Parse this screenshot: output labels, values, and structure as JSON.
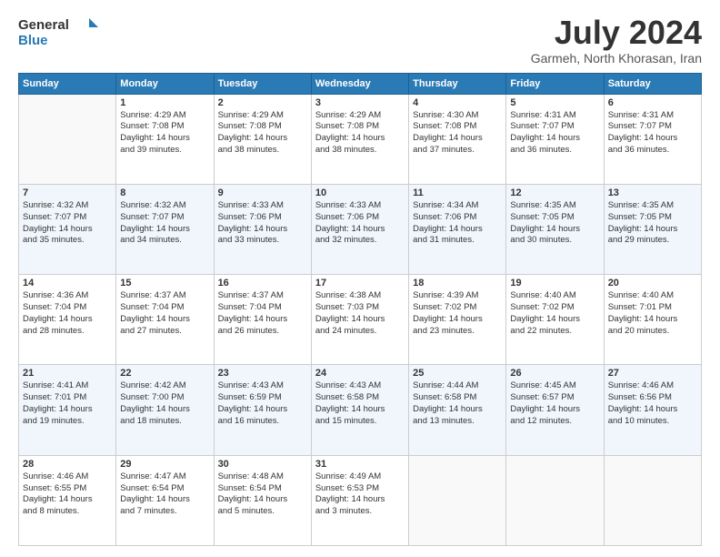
{
  "logo": {
    "line1": "General",
    "line2": "Blue"
  },
  "title": "July 2024",
  "subtitle": "Garmeh, North Khorasan, Iran",
  "days_header": [
    "Sunday",
    "Monday",
    "Tuesday",
    "Wednesday",
    "Thursday",
    "Friday",
    "Saturday"
  ],
  "weeks": [
    [
      {
        "day": "",
        "info": ""
      },
      {
        "day": "1",
        "info": "Sunrise: 4:29 AM\nSunset: 7:08 PM\nDaylight: 14 hours\nand 39 minutes."
      },
      {
        "day": "2",
        "info": "Sunrise: 4:29 AM\nSunset: 7:08 PM\nDaylight: 14 hours\nand 38 minutes."
      },
      {
        "day": "3",
        "info": "Sunrise: 4:29 AM\nSunset: 7:08 PM\nDaylight: 14 hours\nand 38 minutes."
      },
      {
        "day": "4",
        "info": "Sunrise: 4:30 AM\nSunset: 7:08 PM\nDaylight: 14 hours\nand 37 minutes."
      },
      {
        "day": "5",
        "info": "Sunrise: 4:31 AM\nSunset: 7:07 PM\nDaylight: 14 hours\nand 36 minutes."
      },
      {
        "day": "6",
        "info": "Sunrise: 4:31 AM\nSunset: 7:07 PM\nDaylight: 14 hours\nand 36 minutes."
      }
    ],
    [
      {
        "day": "7",
        "info": "Sunrise: 4:32 AM\nSunset: 7:07 PM\nDaylight: 14 hours\nand 35 minutes."
      },
      {
        "day": "8",
        "info": "Sunrise: 4:32 AM\nSunset: 7:07 PM\nDaylight: 14 hours\nand 34 minutes."
      },
      {
        "day": "9",
        "info": "Sunrise: 4:33 AM\nSunset: 7:06 PM\nDaylight: 14 hours\nand 33 minutes."
      },
      {
        "day": "10",
        "info": "Sunrise: 4:33 AM\nSunset: 7:06 PM\nDaylight: 14 hours\nand 32 minutes."
      },
      {
        "day": "11",
        "info": "Sunrise: 4:34 AM\nSunset: 7:06 PM\nDaylight: 14 hours\nand 31 minutes."
      },
      {
        "day": "12",
        "info": "Sunrise: 4:35 AM\nSunset: 7:05 PM\nDaylight: 14 hours\nand 30 minutes."
      },
      {
        "day": "13",
        "info": "Sunrise: 4:35 AM\nSunset: 7:05 PM\nDaylight: 14 hours\nand 29 minutes."
      }
    ],
    [
      {
        "day": "14",
        "info": "Sunrise: 4:36 AM\nSunset: 7:04 PM\nDaylight: 14 hours\nand 28 minutes."
      },
      {
        "day": "15",
        "info": "Sunrise: 4:37 AM\nSunset: 7:04 PM\nDaylight: 14 hours\nand 27 minutes."
      },
      {
        "day": "16",
        "info": "Sunrise: 4:37 AM\nSunset: 7:04 PM\nDaylight: 14 hours\nand 26 minutes."
      },
      {
        "day": "17",
        "info": "Sunrise: 4:38 AM\nSunset: 7:03 PM\nDaylight: 14 hours\nand 24 minutes."
      },
      {
        "day": "18",
        "info": "Sunrise: 4:39 AM\nSunset: 7:02 PM\nDaylight: 14 hours\nand 23 minutes."
      },
      {
        "day": "19",
        "info": "Sunrise: 4:40 AM\nSunset: 7:02 PM\nDaylight: 14 hours\nand 22 minutes."
      },
      {
        "day": "20",
        "info": "Sunrise: 4:40 AM\nSunset: 7:01 PM\nDaylight: 14 hours\nand 20 minutes."
      }
    ],
    [
      {
        "day": "21",
        "info": "Sunrise: 4:41 AM\nSunset: 7:01 PM\nDaylight: 14 hours\nand 19 minutes."
      },
      {
        "day": "22",
        "info": "Sunrise: 4:42 AM\nSunset: 7:00 PM\nDaylight: 14 hours\nand 18 minutes."
      },
      {
        "day": "23",
        "info": "Sunrise: 4:43 AM\nSunset: 6:59 PM\nDaylight: 14 hours\nand 16 minutes."
      },
      {
        "day": "24",
        "info": "Sunrise: 4:43 AM\nSunset: 6:58 PM\nDaylight: 14 hours\nand 15 minutes."
      },
      {
        "day": "25",
        "info": "Sunrise: 4:44 AM\nSunset: 6:58 PM\nDaylight: 14 hours\nand 13 minutes."
      },
      {
        "day": "26",
        "info": "Sunrise: 4:45 AM\nSunset: 6:57 PM\nDaylight: 14 hours\nand 12 minutes."
      },
      {
        "day": "27",
        "info": "Sunrise: 4:46 AM\nSunset: 6:56 PM\nDaylight: 14 hours\nand 10 minutes."
      }
    ],
    [
      {
        "day": "28",
        "info": "Sunrise: 4:46 AM\nSunset: 6:55 PM\nDaylight: 14 hours\nand 8 minutes."
      },
      {
        "day": "29",
        "info": "Sunrise: 4:47 AM\nSunset: 6:54 PM\nDaylight: 14 hours\nand 7 minutes."
      },
      {
        "day": "30",
        "info": "Sunrise: 4:48 AM\nSunset: 6:54 PM\nDaylight: 14 hours\nand 5 minutes."
      },
      {
        "day": "31",
        "info": "Sunrise: 4:49 AM\nSunset: 6:53 PM\nDaylight: 14 hours\nand 3 minutes."
      },
      {
        "day": "",
        "info": ""
      },
      {
        "day": "",
        "info": ""
      },
      {
        "day": "",
        "info": ""
      }
    ]
  ]
}
